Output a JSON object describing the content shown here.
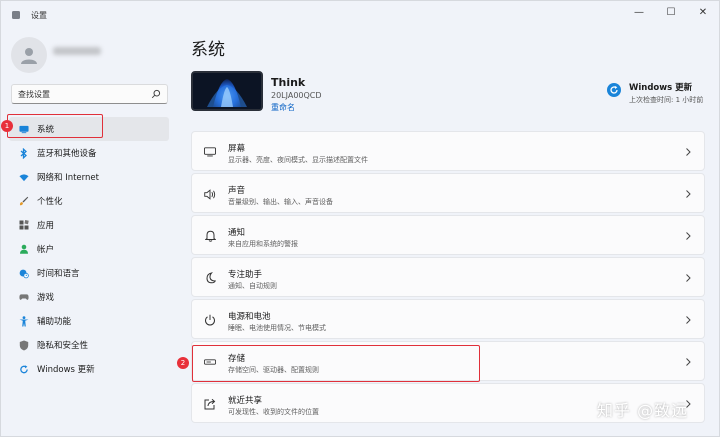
{
  "window": {
    "title": "设置",
    "controls": {
      "minimize": "—",
      "maximize": "☐",
      "close": "✕"
    }
  },
  "sidebar": {
    "search": {
      "value": "查找设置",
      "icon": "search-icon"
    },
    "items": [
      {
        "label": "系统",
        "icon": "monitor-icon",
        "color": "#1a84d9",
        "active": true
      },
      {
        "label": "蓝牙和其他设备",
        "icon": "bluetooth-icon",
        "color": "#1a84d9"
      },
      {
        "label": "网络和 Internet",
        "icon": "wifi-icon",
        "color": "#1a84d9"
      },
      {
        "label": "个性化",
        "icon": "brush-icon",
        "color": "#e39a2b"
      },
      {
        "label": "应用",
        "icon": "apps-icon",
        "color": "#555"
      },
      {
        "label": "帐户",
        "icon": "person-icon",
        "color": "#2bab5c"
      },
      {
        "label": "时间和语言",
        "icon": "globe-clock-icon",
        "color": "#1a84d9"
      },
      {
        "label": "游戏",
        "icon": "gamepad-icon",
        "color": "#777"
      },
      {
        "label": "辅助功能",
        "icon": "accessibility-icon",
        "color": "#1a84d9"
      },
      {
        "label": "隐私和安全性",
        "icon": "shield-icon",
        "color": "#777"
      },
      {
        "label": "Windows 更新",
        "icon": "update-icon",
        "color": "#1a84d9"
      }
    ]
  },
  "annotations": {
    "badge1": "1",
    "badge2": "2"
  },
  "main": {
    "title": "系统",
    "device": {
      "name": "Think",
      "model": "20LJA00QCD",
      "rename": "重命名"
    },
    "update": {
      "title": "Windows 更新",
      "subtitle": "上次检查时间: 1 小时前"
    },
    "cards": [
      {
        "title": "屏幕",
        "subtitle": "显示器、亮度、夜间模式、显示描述配置文件",
        "icon": "display-icon"
      },
      {
        "title": "声音",
        "subtitle": "音量级别、输出、输入、声音设备",
        "icon": "speaker-icon"
      },
      {
        "title": "通知",
        "subtitle": "来自应用和系统的警报",
        "icon": "bell-icon"
      },
      {
        "title": "专注助手",
        "subtitle": "通知、自动规则",
        "icon": "moon-icon"
      },
      {
        "title": "电源和电池",
        "subtitle": "睡眠、电池使用情况、节电模式",
        "icon": "power-icon"
      },
      {
        "title": "存储",
        "subtitle": "存储空间、驱动器、配置规则",
        "icon": "storage-icon"
      },
      {
        "title": "就近共享",
        "subtitle": "可发现性、收到的文件的位置",
        "icon": "share-icon"
      }
    ]
  },
  "watermark": "知乎 @致远"
}
